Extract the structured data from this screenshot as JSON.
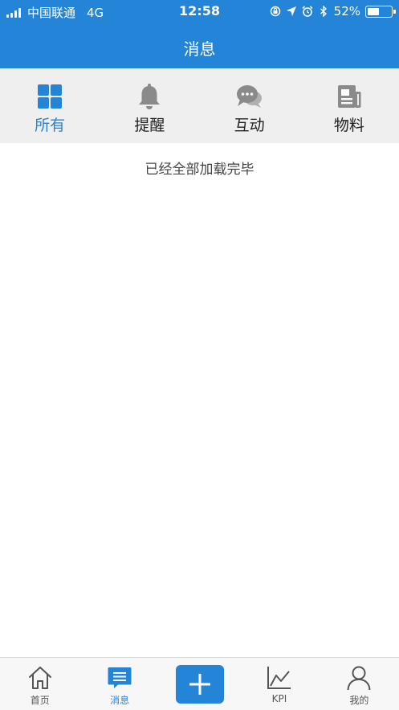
{
  "status_bar": {
    "carrier": "中国联通",
    "network": "4G",
    "time": "12:58",
    "battery": "52%",
    "battery_level": 0.52
  },
  "header": {
    "title": "消息"
  },
  "tabs": [
    {
      "label": "所有",
      "icon": "grid-icon",
      "active": true
    },
    {
      "label": "提醒",
      "icon": "bell-icon",
      "active": false
    },
    {
      "label": "互动",
      "icon": "chat-bubbles-icon",
      "active": false
    },
    {
      "label": "物料",
      "icon": "document-icon",
      "active": false
    }
  ],
  "content": {
    "status_message": "已经全部加载完毕"
  },
  "bottom_nav": [
    {
      "label": "首页",
      "icon": "home-icon",
      "active": false
    },
    {
      "label": "消息",
      "icon": "message-icon",
      "active": true
    },
    {
      "label": "",
      "icon": "plus-icon",
      "active": false
    },
    {
      "label": "KPI",
      "icon": "line-chart-icon",
      "active": false
    },
    {
      "label": "我的",
      "icon": "user-icon",
      "active": false
    }
  ],
  "colors": {
    "accent": "#2384d8",
    "tab_bg": "#efefef",
    "icon_gray": "#8a8a8a"
  }
}
